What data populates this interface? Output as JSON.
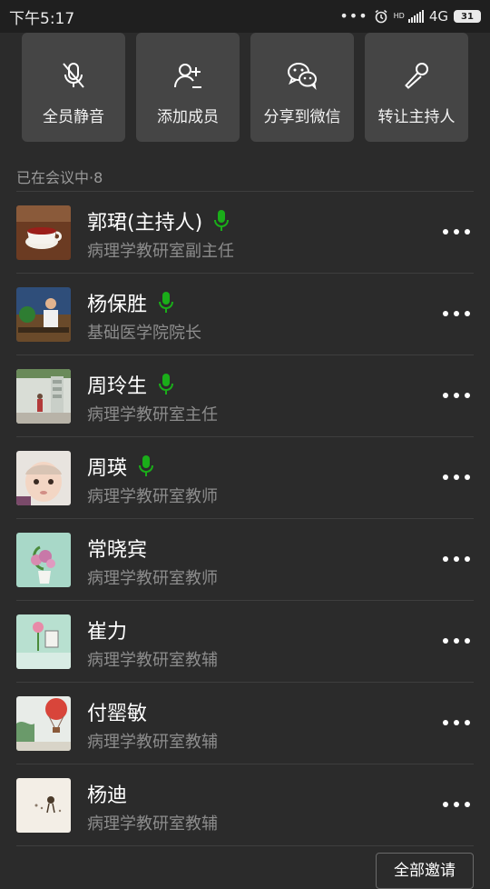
{
  "status_bar": {
    "time": "下午5:17",
    "network": "4G",
    "hd_label": "HD",
    "battery": "31"
  },
  "actions": [
    {
      "label": "全员静音",
      "icon": "mic-muted-icon"
    },
    {
      "label": "添加成员",
      "icon": "add-person-icon"
    },
    {
      "label": "分享到微信",
      "icon": "wechat-icon"
    },
    {
      "label": "转让主持人",
      "icon": "mic-transfer-icon"
    }
  ],
  "section": {
    "title": "已在会议中·8"
  },
  "members": [
    {
      "name": "郭珺(主持人)",
      "role": "病理学教研室副主任",
      "speaking": true
    },
    {
      "name": "杨保胜",
      "role": "基础医学院院长",
      "speaking": true
    },
    {
      "name": "周玲生",
      "role": "病理学教研室主任",
      "speaking": true
    },
    {
      "name": "周瑛",
      "role": "病理学教研室教师",
      "speaking": true
    },
    {
      "name": "常晓宾",
      "role": "病理学教研室教师",
      "speaking": false
    },
    {
      "name": "崔力",
      "role": "病理学教研室教辅",
      "speaking": false
    },
    {
      "name": "付罂敏",
      "role": "病理学教研室教辅",
      "speaking": false
    },
    {
      "name": "杨迪",
      "role": "病理学教研室教辅",
      "speaking": false
    }
  ],
  "invite_button": "全部邀请",
  "colors": {
    "background": "#2b2b2b",
    "tile": "#454545",
    "mic_active": "#1aad19",
    "secondary_text": "#8c8c8c"
  }
}
